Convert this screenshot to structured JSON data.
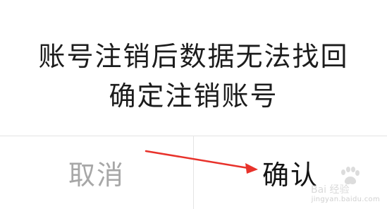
{
  "dialog": {
    "message_lines": [
      "账号注销后数据无法找回",
      "确定注销账号"
    ],
    "cancel_label": "取消",
    "confirm_label": "确认"
  },
  "annotation": {
    "arrow_color": "#e8322b"
  },
  "watermark": {
    "logo_text": "Bai 经验",
    "url_text": "jingyan.baidu.com"
  },
  "colors": {
    "message_text": "#1c1c1c",
    "cancel_text": "#a7a7a7",
    "confirm_text": "#141414",
    "divider": "#e4e4e4"
  }
}
